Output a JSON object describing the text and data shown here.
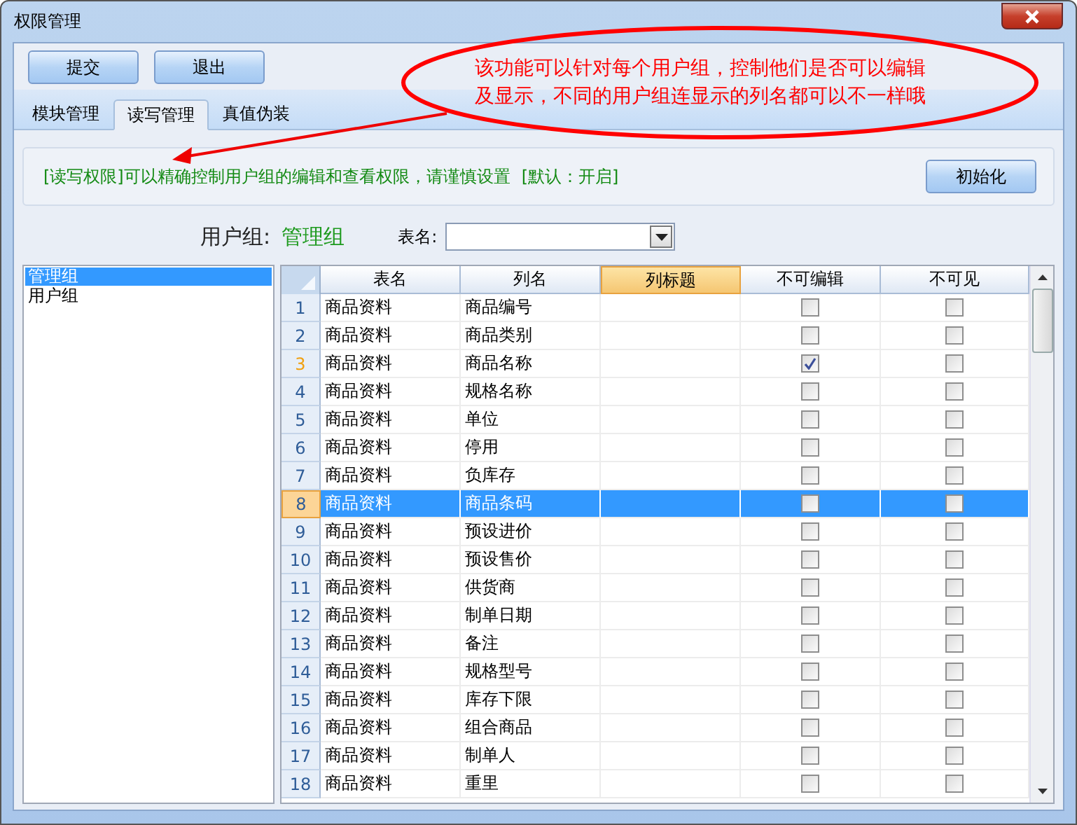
{
  "window": {
    "title": "权限管理"
  },
  "toolbar": {
    "buttons": [
      "提交",
      "退出"
    ]
  },
  "tabs": [
    {
      "label": "模块管理",
      "selected": false
    },
    {
      "label": "读写管理",
      "selected": true
    },
    {
      "label": "真值伪装",
      "selected": false
    }
  ],
  "info": {
    "text": "[读写权限]可以精确控制用户组的编辑和查看权限，请谨慎设置",
    "default_text": "[默认：开启]",
    "button": "初始化"
  },
  "user_group": {
    "label": "用户组:",
    "value": "管理组"
  },
  "table_filter": {
    "label": "表名:"
  },
  "groups": [
    {
      "label": "管理组",
      "selected": true
    },
    {
      "label": "用户组",
      "selected": false
    }
  ],
  "table": {
    "columns": [
      {
        "label": "表名",
        "sorted": false
      },
      {
        "label": "列名",
        "sorted": false
      },
      {
        "label": "列标题",
        "sorted": true
      },
      {
        "label": "不可编辑",
        "sorted": false
      },
      {
        "label": "不可见",
        "sorted": false
      }
    ],
    "rows": [
      {
        "num": "1",
        "table": "商品资料",
        "column": "商品编号",
        "no_edit": false,
        "hidden": false,
        "selected": false,
        "current": false
      },
      {
        "num": "2",
        "table": "商品资料",
        "column": "商品类别",
        "no_edit": false,
        "hidden": false,
        "selected": false,
        "current": false
      },
      {
        "num": "3",
        "table": "商品资料",
        "column": "商品名称",
        "no_edit": true,
        "hidden": false,
        "selected": false,
        "current": true
      },
      {
        "num": "4",
        "table": "商品资料",
        "column": "规格名称",
        "no_edit": false,
        "hidden": false,
        "selected": false,
        "current": false
      },
      {
        "num": "5",
        "table": "商品资料",
        "column": "单位",
        "no_edit": false,
        "hidden": false,
        "selected": false,
        "current": false
      },
      {
        "num": "6",
        "table": "商品资料",
        "column": "停用",
        "no_edit": false,
        "hidden": false,
        "selected": false,
        "current": false
      },
      {
        "num": "7",
        "table": "商品资料",
        "column": "负库存",
        "no_edit": false,
        "hidden": false,
        "selected": false,
        "current": false
      },
      {
        "num": "8",
        "table": "商品资料",
        "column": "商品条码",
        "no_edit": false,
        "hidden": false,
        "selected": true,
        "current": false
      },
      {
        "num": "9",
        "table": "商品资料",
        "column": "预设进价",
        "no_edit": false,
        "hidden": false,
        "selected": false,
        "current": false
      },
      {
        "num": "10",
        "table": "商品资料",
        "column": "预设售价",
        "no_edit": false,
        "hidden": false,
        "selected": false,
        "current": false
      },
      {
        "num": "11",
        "table": "商品资料",
        "column": "供货商",
        "no_edit": false,
        "hidden": false,
        "selected": false,
        "current": false
      },
      {
        "num": "12",
        "table": "商品资料",
        "column": "制单日期",
        "no_edit": false,
        "hidden": false,
        "selected": false,
        "current": false
      },
      {
        "num": "13",
        "table": "商品资料",
        "column": "备注",
        "no_edit": false,
        "hidden": false,
        "selected": false,
        "current": false
      },
      {
        "num": "14",
        "table": "商品资料",
        "column": "规格型号",
        "no_edit": false,
        "hidden": false,
        "selected": false,
        "current": false
      },
      {
        "num": "15",
        "table": "商品资料",
        "column": "库存下限",
        "no_edit": false,
        "hidden": false,
        "selected": false,
        "current": false
      },
      {
        "num": "16",
        "table": "商品资料",
        "column": "组合商品",
        "no_edit": false,
        "hidden": false,
        "selected": false,
        "current": false
      },
      {
        "num": "17",
        "table": "商品资料",
        "column": "制单人",
        "no_edit": false,
        "hidden": false,
        "selected": false,
        "current": false
      },
      {
        "num": "18",
        "table": "商品资料",
        "column": "重里",
        "no_edit": false,
        "hidden": false,
        "selected": false,
        "current": false
      }
    ]
  },
  "annotation": {
    "lines": [
      "该功能可以针对每个用户组，控制他们是否可以编辑",
      "及显示，不同的用户组连显示的列名都可以不一样哦"
    ]
  }
}
